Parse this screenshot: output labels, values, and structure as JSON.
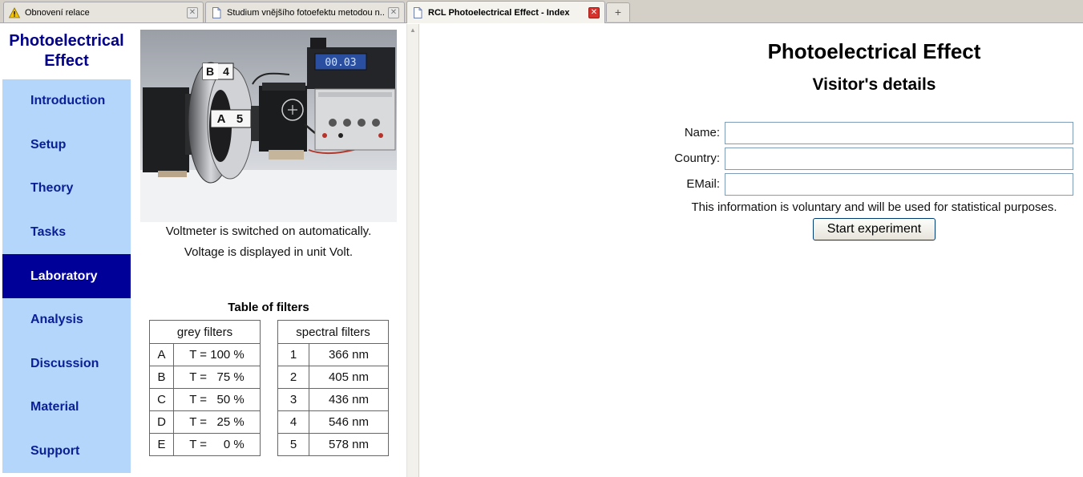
{
  "tabs": [
    {
      "label": "Obnovení relace",
      "icon": "warning-icon",
      "active": false
    },
    {
      "label": "Studium vnějšího fotoefektu metodou n...",
      "icon": "page-icon",
      "active": false
    },
    {
      "label": "RCL Photoelectrical Effect - Index",
      "icon": "page-icon",
      "active": true
    }
  ],
  "new_tab_label": "+",
  "sidebar": {
    "brand": "Photoelectrical Effect",
    "items": [
      {
        "label": "Introduction"
      },
      {
        "label": "Setup"
      },
      {
        "label": "Theory"
      },
      {
        "label": "Tasks"
      },
      {
        "label": "Laboratory",
        "active": true
      },
      {
        "label": "Analysis"
      },
      {
        "label": "Discussion"
      },
      {
        "label": "Material"
      },
      {
        "label": "Support"
      }
    ]
  },
  "apparatus": {
    "captions": [
      "Voltmeter is switched on automatically.",
      "Voltage is displayed in unit Volt."
    ],
    "display_reading": "00.03",
    "wheel_labels": {
      "top_letter": "B",
      "top_number": "4",
      "bottom_letter": "A",
      "bottom_number": "5"
    }
  },
  "filters": {
    "title": "Table of filters",
    "grey": {
      "header": "grey filters",
      "rows": [
        {
          "id": "A",
          "value": "T = 100 %"
        },
        {
          "id": "B",
          "value": "T =   75 %"
        },
        {
          "id": "C",
          "value": "T =   50 %"
        },
        {
          "id": "D",
          "value": "T =   25 %"
        },
        {
          "id": "E",
          "value": "T =     0 %"
        }
      ]
    },
    "spectral": {
      "header": "spectral filters",
      "rows": [
        {
          "id": "1",
          "value": "366 nm"
        },
        {
          "id": "2",
          "value": "405 nm"
        },
        {
          "id": "3",
          "value": "436 nm"
        },
        {
          "id": "4",
          "value": "546 nm"
        },
        {
          "id": "5",
          "value": "578 nm"
        }
      ]
    }
  },
  "main": {
    "title": "Photoelectrical Effect",
    "subtitle": "Visitor's details",
    "fields": [
      {
        "label": "Name:",
        "value": ""
      },
      {
        "label": "Country:",
        "value": ""
      },
      {
        "label": "EMail:",
        "value": ""
      }
    ],
    "note": "This information is voluntary and will be used for statistical purposes.",
    "start_button": "Start experiment"
  },
  "colors": {
    "nav_bg": "#b4d6fb",
    "nav_active_bg": "#000099",
    "nav_text": "#0a1e96",
    "brand_text": "#00008b"
  }
}
